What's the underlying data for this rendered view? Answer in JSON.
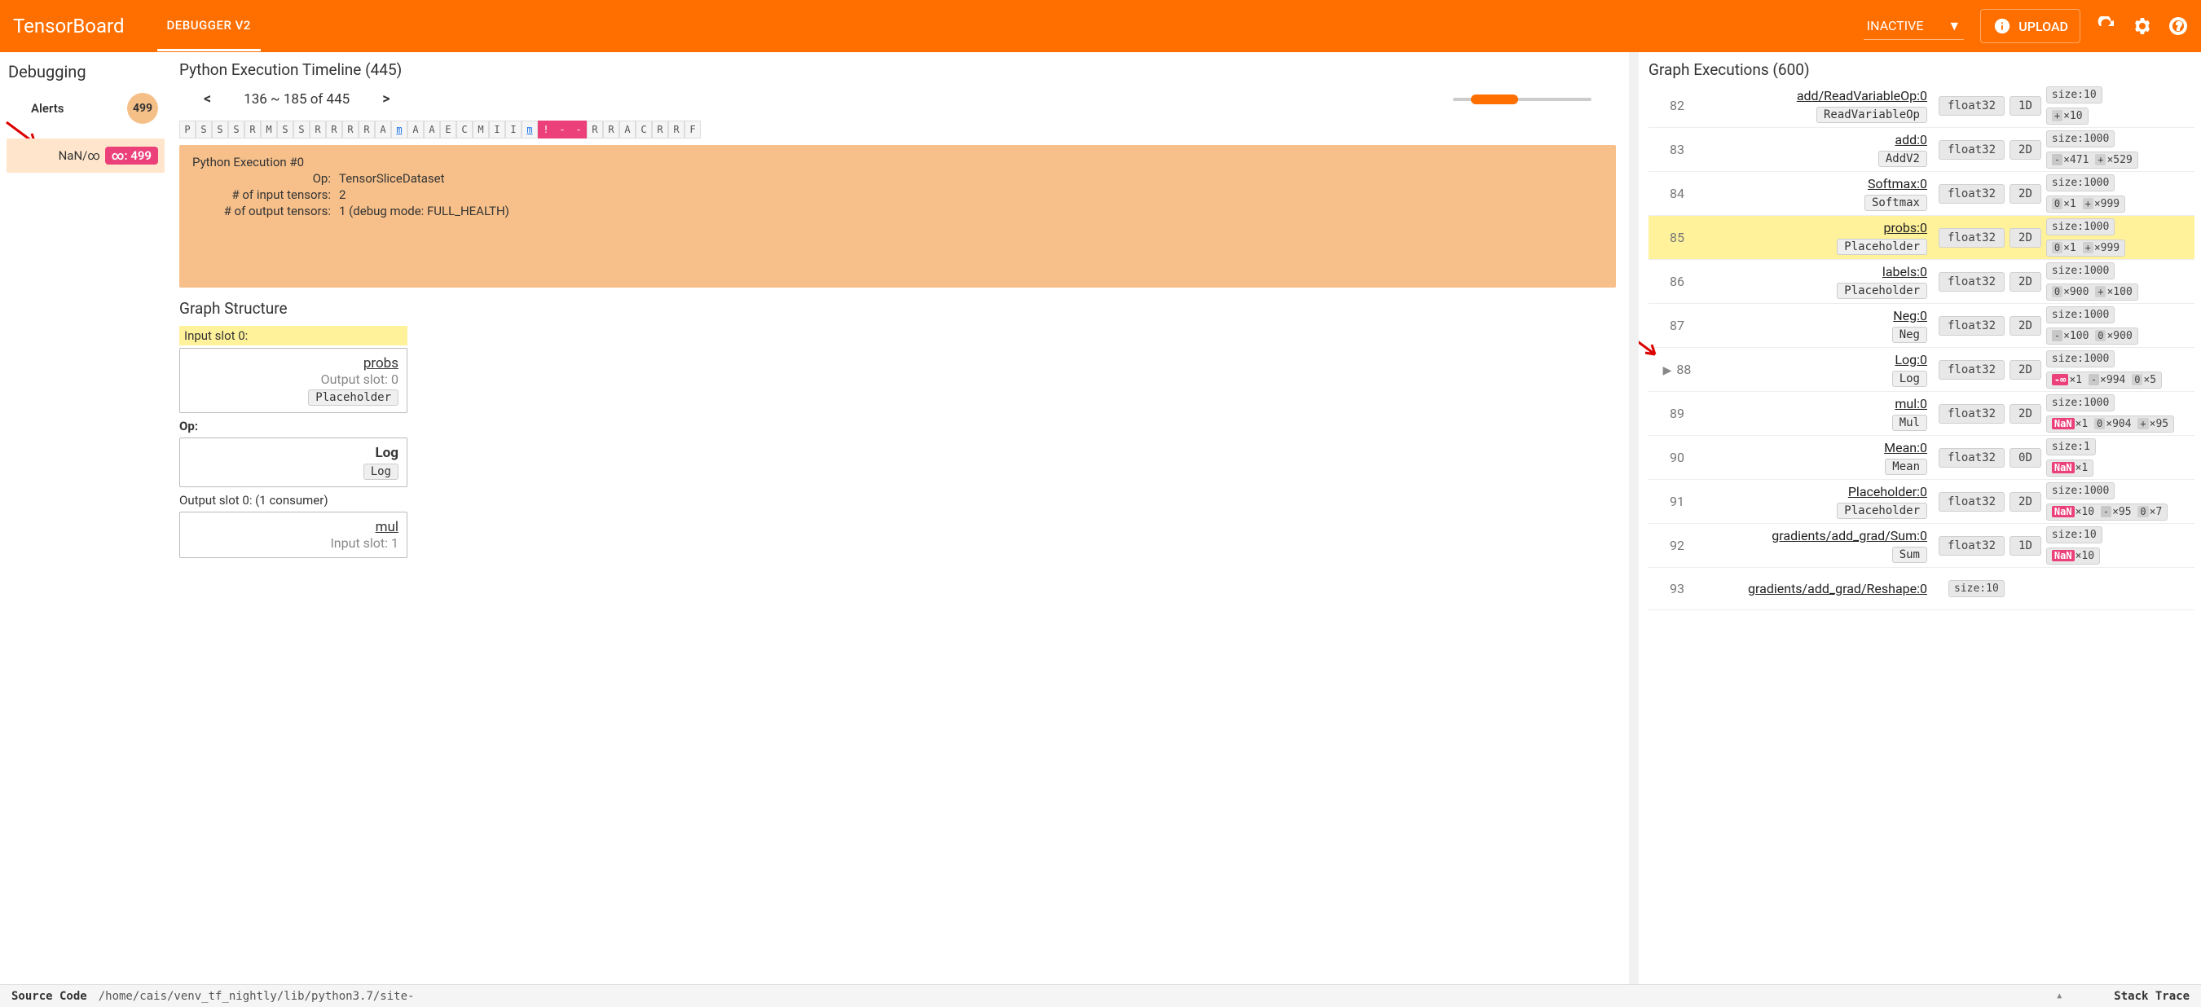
{
  "header": {
    "logo": "TensorBoard",
    "tab": "DEBUGGER V2",
    "mode": "INACTIVE",
    "upload": "UPLOAD"
  },
  "sidebar": {
    "title": "Debugging",
    "alerts_label": "Alerts",
    "alerts_count": "499",
    "alert_item": {
      "label": "NaN/∞",
      "count": ": 499"
    }
  },
  "timeline": {
    "title": "Python Execution Timeline (445)",
    "prev": "<",
    "range": "136 ~ 185 of 445",
    "next": ">",
    "cells": [
      "P",
      "S",
      "S",
      "S",
      "R",
      "M",
      "S",
      "S",
      "R",
      "R",
      "R",
      "R",
      "A",
      "m",
      "A",
      "A",
      "E",
      "C",
      "M",
      "I",
      "I",
      "m",
      "!",
      "-",
      "-",
      "R",
      "R",
      "A",
      "C",
      "R",
      "R",
      "F"
    ]
  },
  "exec": {
    "title": "Python Execution #0",
    "op_k": "Op:",
    "op_v": "TensorSliceDataset",
    "in_k": "# of input tensors:",
    "in_v": "2",
    "out_k": "# of output tensors:",
    "out_v": "1   (debug mode: FULL_HEALTH)"
  },
  "graph_struct": {
    "title": "Graph Structure",
    "input_slot": "Input slot 0:",
    "probs": {
      "name": "probs",
      "slot": "Output slot: 0",
      "op": "Placeholder"
    },
    "op_label": "Op:",
    "log": {
      "name": "Log",
      "op": "Log"
    },
    "output_slot": "Output slot 0: (1 consumer)",
    "mul": {
      "name": "mul",
      "slot": "Input slot: 1"
    }
  },
  "graph_exec": {
    "title": "Graph Executions (600)",
    "rows": [
      {
        "idx": "82",
        "name": "add/ReadVariableOp:0",
        "op": "ReadVariableOp",
        "dtype": "float32",
        "dim": "1D",
        "size": "size:10",
        "stats": [
          [
            "+",
            "×10"
          ]
        ],
        "hl": false
      },
      {
        "idx": "83",
        "name": "add:0",
        "op": "AddV2",
        "dtype": "float32",
        "dim": "2D",
        "size": "size:1000",
        "stats": [
          [
            "-",
            "×471"
          ],
          [
            "+",
            "×529"
          ]
        ],
        "hl": false
      },
      {
        "idx": "84",
        "name": "Softmax:0",
        "op": "Softmax",
        "dtype": "float32",
        "dim": "2D",
        "size": "size:1000",
        "stats": [
          [
            "0",
            "×1"
          ],
          [
            "+",
            "×999"
          ]
        ],
        "hl": false
      },
      {
        "idx": "85",
        "name": "probs:0",
        "op": "Placeholder",
        "dtype": "float32",
        "dim": "2D",
        "size": "size:1000",
        "stats": [
          [
            "0",
            "×1"
          ],
          [
            "+",
            "×999"
          ]
        ],
        "hl": true
      },
      {
        "idx": "86",
        "name": "labels:0",
        "op": "Placeholder",
        "dtype": "float32",
        "dim": "2D",
        "size": "size:1000",
        "stats": [
          [
            "0",
            "×900"
          ],
          [
            "+",
            "×100"
          ]
        ],
        "hl": false
      },
      {
        "idx": "87",
        "name": "Neg:0",
        "op": "Neg",
        "dtype": "float32",
        "dim": "2D",
        "size": "size:1000",
        "stats": [
          [
            "-",
            "×100"
          ],
          [
            "0",
            "×900"
          ]
        ],
        "hl": false
      },
      {
        "idx": "88",
        "name": "Log:0",
        "op": "Log",
        "dtype": "float32",
        "dim": "2D",
        "size": "size:1000",
        "stats": [
          [
            "-∞",
            "×1"
          ],
          [
            "-",
            "×994"
          ],
          [
            "0",
            "×5"
          ]
        ],
        "hl": false,
        "play": true
      },
      {
        "idx": "89",
        "name": "mul:0",
        "op": "Mul",
        "dtype": "float32",
        "dim": "2D",
        "size": "size:1000",
        "stats": [
          [
            "NaN",
            "×1"
          ],
          [
            "0",
            "×904"
          ],
          [
            "+",
            "×95"
          ]
        ],
        "hl": false
      },
      {
        "idx": "90",
        "name": "Mean:0",
        "op": "Mean",
        "dtype": "float32",
        "dim": "0D",
        "size": "size:1",
        "stats": [
          [
            "NaN",
            "×1"
          ]
        ],
        "hl": false
      },
      {
        "idx": "91",
        "name": "Placeholder:0",
        "op": "Placeholder",
        "dtype": "float32",
        "dim": "2D",
        "size": "size:1000",
        "stats": [
          [
            "NaN",
            "×10"
          ],
          [
            "-",
            "×95"
          ],
          [
            "0",
            "×7"
          ]
        ],
        "hl": false
      },
      {
        "idx": "92",
        "name": "gradients/add_grad/Sum:0",
        "op": "Sum",
        "dtype": "float32",
        "dim": "1D",
        "size": "size:10",
        "stats": [
          [
            "NaN",
            "×10"
          ]
        ],
        "hl": false
      },
      {
        "idx": "93",
        "name": "gradients/add_grad/Reshape:0",
        "op": "",
        "dtype": "",
        "dim": "",
        "size": "size:10",
        "stats": [],
        "hl": false
      }
    ]
  },
  "footer": {
    "source": "Source Code",
    "path": "/home/cais/venv_tf_nightly/lib/python3.7/site-",
    "stack": "Stack Trace"
  }
}
